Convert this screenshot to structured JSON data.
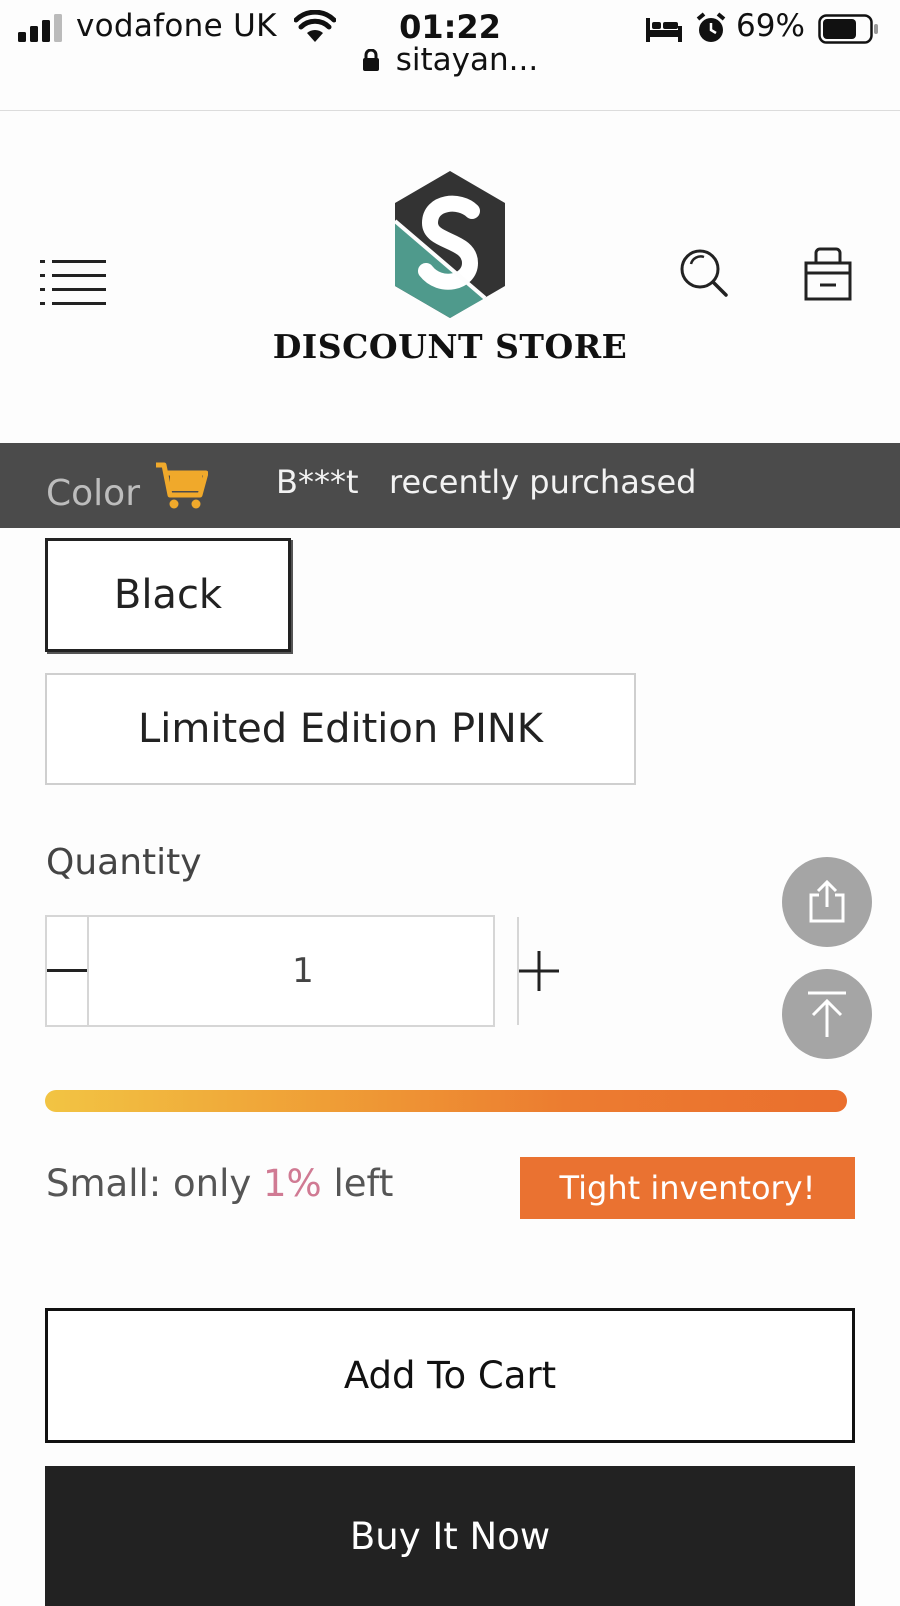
{
  "status_bar": {
    "carrier": "vodafone UK",
    "time": "01:22",
    "url": "sitayan...",
    "battery": "69%",
    "icons": [
      "signal-icon",
      "wifi-icon",
      "lock-icon",
      "bed-icon",
      "alarm-icon",
      "battery-icon"
    ]
  },
  "header": {
    "store_name": "DISCOUNT STORE",
    "logo_letter": "S",
    "icons": [
      "menu-icon",
      "logo",
      "search-icon",
      "shopping-bag-icon"
    ]
  },
  "toast": {
    "label": "Color",
    "buyer": "B***t",
    "message": "recently purchased"
  },
  "variants": {
    "options": [
      "Black",
      "Limited Edition PINK"
    ],
    "selected": "Black"
  },
  "quantity": {
    "label": "Quantity",
    "value": "1"
  },
  "inventory": {
    "prefix": "Small: only ",
    "percent": "1%",
    "suffix": " left",
    "badge": "Tight inventory!",
    "bar_fill_percent": 100
  },
  "actions": {
    "add_to_cart": "Add To Cart",
    "buy_now": "Buy It Now"
  },
  "colors": {
    "toast_bg": "#4b4b4b",
    "cart_icon": "#f0a92b",
    "badge_bg": "#ea7231",
    "percent_text": "#d07a93",
    "buy_now_bg": "#222222"
  }
}
